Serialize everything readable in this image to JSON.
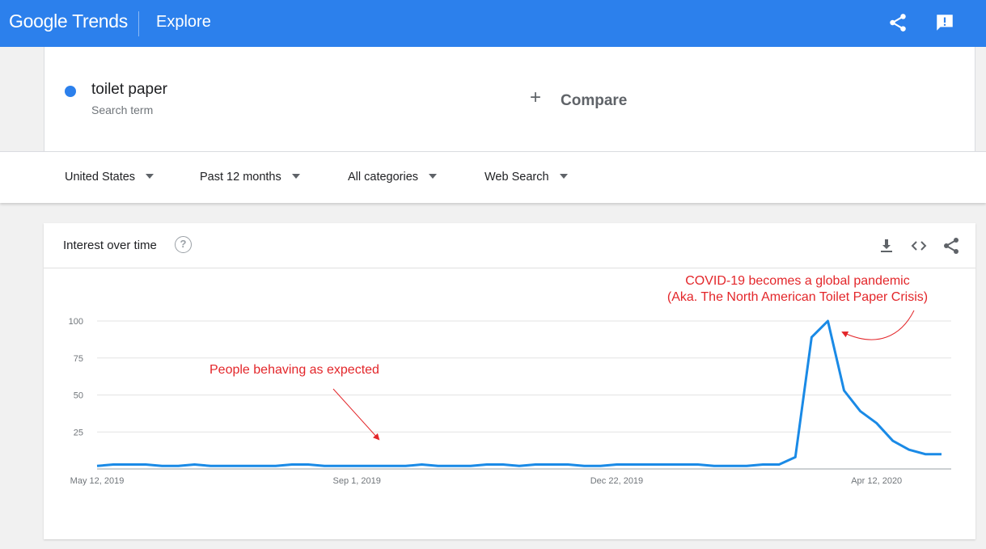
{
  "header": {
    "logo_google": "Google",
    "logo_trends": "Trends",
    "page_title": "Explore",
    "share_icon": "share-icon",
    "feedback_icon": "feedback-icon",
    "bar_color": "#2c80ec"
  },
  "search_term": {
    "name": "toilet paper",
    "subtitle": "Search term",
    "dot_color": "#2c80ec"
  },
  "compare": {
    "plus": "+",
    "label": "Compare"
  },
  "filters": {
    "region": "United States",
    "time_range": "Past 12 months",
    "category": "All categories",
    "search_type": "Web Search"
  },
  "card": {
    "title": "Interest over time",
    "help_icon": "?",
    "download_icon": "download-icon",
    "embed_icon": "embed-code-icon",
    "share_icon": "share-icon"
  },
  "annotations": {
    "normal_label": "People behaving as expected",
    "spike_line1": "COVID-19 becomes a global pandemic",
    "spike_line2": "(Aka. The North American Toilet Paper Crisis)",
    "color": "#e3262a"
  },
  "chart_data": {
    "type": "line",
    "title": "",
    "xlabel": "",
    "ylabel": "",
    "ylim": [
      0,
      100
    ],
    "y_ticks": [
      "25",
      "50",
      "75",
      "100"
    ],
    "x_tick_labels": [
      "May 12, 2019",
      "Sep 1, 2019",
      "Dec 22, 2019",
      "Apr 12, 2020"
    ],
    "grid": true,
    "line_color": "#1a8ae6",
    "series": [
      {
        "values": [
          2,
          3,
          3,
          3,
          2,
          2,
          3,
          2,
          2,
          2,
          2,
          2,
          3,
          3,
          2,
          2,
          2,
          2,
          2,
          2,
          3,
          2,
          2,
          2,
          3,
          3,
          2,
          3,
          3,
          3,
          2,
          2,
          3,
          3,
          3,
          3,
          3,
          3,
          2,
          2,
          2,
          3,
          3,
          8,
          89,
          100,
          53,
          39,
          31,
          19,
          13,
          10,
          10
        ]
      }
    ]
  }
}
